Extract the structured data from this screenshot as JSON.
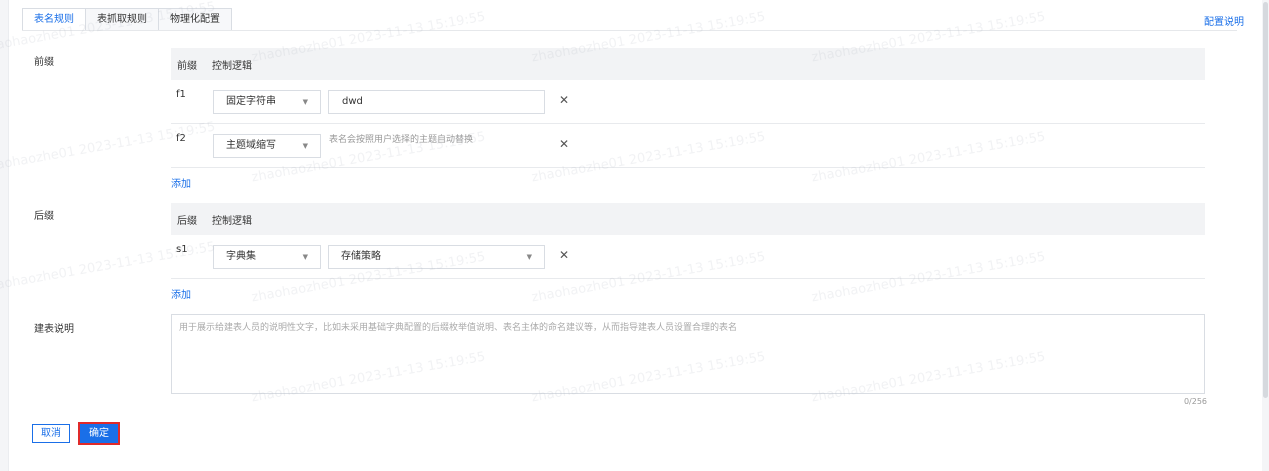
{
  "tabs": [
    {
      "label": "表名规则",
      "active": true
    },
    {
      "label": "表抓取规则",
      "active": false
    },
    {
      "label": "物理化配置",
      "active": false
    }
  ],
  "config_link": "配置说明",
  "prefix": {
    "label": "前缀",
    "header": {
      "col1": "前缀",
      "col2": "控制逻辑"
    },
    "rows": [
      {
        "id": "f1",
        "type": "固定字符串",
        "value": "dwd",
        "hint": ""
      },
      {
        "id": "f2",
        "type": "主题域缩写",
        "value": "",
        "hint": "表名会按照用户选择的主题自动替换"
      }
    ],
    "add_label": "添加"
  },
  "suffix": {
    "label": "后缀",
    "header": {
      "col1": "后缀",
      "col2": "控制逻辑"
    },
    "rows": [
      {
        "id": "s1",
        "type": "字典集",
        "value": "存储策略"
      }
    ],
    "add_label": "添加"
  },
  "description": {
    "label": "建表说明",
    "placeholder": "用于展示给建表人员的说明性文字，比如未采用基础字典配置的后缀枚举值说明、表名主体的命名建议等，从而指导建表人员设置合理的表名",
    "counter": "0/256"
  },
  "buttons": {
    "cancel": "取消",
    "ok": "确定"
  },
  "icons": {
    "close": "close-icon",
    "dropdown": "chevron-down-icon"
  },
  "watermark": "zhaohaozhe01 2023-11-13 15:19:55",
  "colors": {
    "accent": "#1a6fe8",
    "highlight": "#e02a2a"
  }
}
